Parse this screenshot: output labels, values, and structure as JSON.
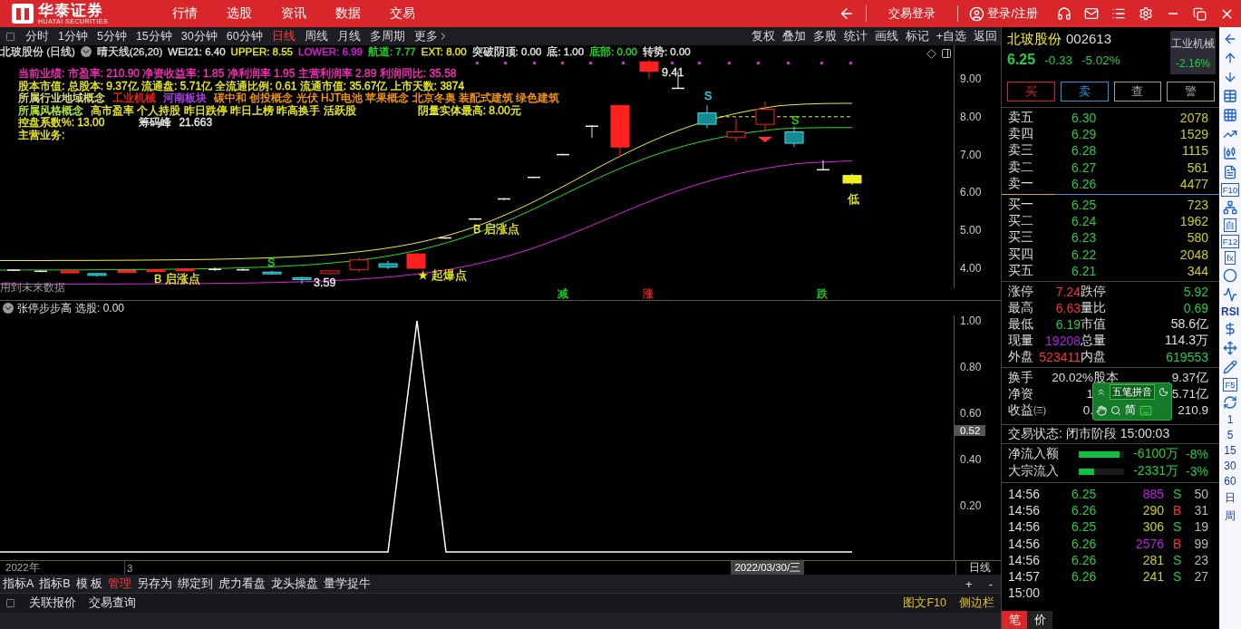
{
  "app": {
    "logo_cn": "华泰证券",
    "logo_en": "HUATAI SECURITIES"
  },
  "top_nav": [
    "行情",
    "选股",
    "资讯",
    "数据",
    "交易"
  ],
  "top_right": {
    "trade_login": "交易登录",
    "user": "登录/注册"
  },
  "periods": [
    {
      "label": "分时",
      "selected": false
    },
    {
      "label": "1分钟",
      "selected": false
    },
    {
      "label": "5分钟",
      "selected": false
    },
    {
      "label": "15分钟",
      "selected": false
    },
    {
      "label": "30分钟",
      "selected": false
    },
    {
      "label": "60分钟",
      "selected": false
    },
    {
      "label": "日线",
      "selected": true
    },
    {
      "label": "周线",
      "selected": false
    },
    {
      "label": "月线",
      "selected": false
    },
    {
      "label": "多周期",
      "selected": false
    },
    {
      "label": "更多",
      "selected": false
    }
  ],
  "chart_tools": [
    "复权",
    "叠加",
    "多股",
    "统计",
    "画线",
    "标记",
    "+自选",
    "返回"
  ],
  "chart_title": {
    "name": "北玻股份 (日线)",
    "indicator": "晴天线(26,20)",
    "params": [
      {
        "text": "WEI21: 6.40",
        "color": "#e6e6e6"
      },
      {
        "text": "UPPER: 8.55",
        "color": "#f0f000"
      },
      {
        "text": "LOWER: 6.99",
        "color": "#e020e0"
      },
      {
        "text": "航道: 7.77",
        "color": "#20e020"
      },
      {
        "text": "EXT: 8.00",
        "color": "#f0f000"
      },
      {
        "text": "突破阴顶: 0.00",
        "color": "#e6e6e6"
      },
      {
        "text": "底: 1.00",
        "color": "#e6e6e6"
      },
      {
        "text": "底部: 0.00",
        "color": "#20e020"
      },
      {
        "text": "转势: 0.00",
        "color": "#e6e6e6"
      }
    ]
  },
  "info_lines": [
    [
      {
        "text": "当前业绩: 市盈率: 210.90 净资收益率: 1.85 净利润率 1.95 主营利润率 2.89 利润同比: 35.58",
        "color": "#ff30c0"
      }
    ],
    [
      {
        "text": "股本市值: 总股本: 9.37亿 流通盘: 5.71亿 全流通比例: 0.61 流通市值: 35.67亿 上市天数: 3874",
        "color": "#f0f020"
      }
    ],
    [
      {
        "text": "所属行业地域概念",
        "color": "#e8e880"
      },
      {
        "text": "工业机械",
        "color": "#ff2020"
      },
      {
        "text": "河南板块",
        "color": "#c040ff"
      },
      {
        "text": "碳中和 创投概念 光伏 HJT电池 苹果概念 北京冬奥 装配式建筑 绿色建筑",
        "color": "#ff9a10"
      }
    ],
    [
      {
        "text": "所属风格概念",
        "color": "#b8f040"
      },
      {
        "text": "高市盈率 个人持股 昨日跌停 昨日上榜 昨高换手 活跃股",
        "color": "#f0f020"
      },
      {
        "text": "阴量实体最高:  8.00元",
        "color": "#f0f020"
      }
    ],
    [
      {
        "text": "控盘系数%:  13.00",
        "color": "#f0f020"
      },
      {
        "text": "筹码峰",
        "color": "#f0f0f0"
      },
      {
        "text": "21.663",
        "color": "#f0f0f0"
      }
    ],
    [
      {
        "text": "主营业务:",
        "color": "#f0f020"
      }
    ]
  ],
  "chart_labels": [
    {
      "text": "9.41",
      "color": "#f0f0f0"
    },
    {
      "text": "S",
      "color": "#30e0f0"
    },
    {
      "text": "S",
      "color": "#20e020"
    },
    {
      "text": "低",
      "color": "#f0f020"
    },
    {
      "text": "B 启涨点",
      "color": "#f0f020"
    },
    {
      "text": "B 启涨点",
      "color": "#f0f020"
    },
    {
      "text": "S",
      "color": "#20e020"
    },
    {
      "text": "3.59",
      "color": "#f0f0f0"
    },
    {
      "text": "★ 起爆点",
      "color": "#f0f020"
    }
  ],
  "price_ticks": [
    "9.00",
    "8.00",
    "7.00",
    "6.00",
    "5.00",
    "4.00"
  ],
  "future_note": "用到未来数据",
  "signals": [
    {
      "text": "减",
      "color": "#20c020"
    },
    {
      "text": "涨",
      "color": "#e02020"
    },
    {
      "text": "跌",
      "color": "#20c020"
    }
  ],
  "indicator": {
    "name": "张停步步高",
    "value": "选股: 0.00",
    "current": "0.52",
    "ticks": [
      "1.00",
      "0.80",
      "0.60",
      "0.40",
      "0.20"
    ]
  },
  "date_bar": {
    "year": "2022年",
    "month": "3",
    "cursor_date": "2022/03/30/三",
    "period": "日线"
  },
  "bottom_tabs": [
    {
      "label": "指标A",
      "selected": false
    },
    {
      "label": "指标B",
      "selected": false
    },
    {
      "label": "模 板",
      "selected": false
    },
    {
      "label": "管理",
      "selected": true
    },
    {
      "label": "另存为",
      "selected": false
    },
    {
      "label": "绑定到",
      "selected": false
    },
    {
      "label": "虎力看盘",
      "selected": false
    },
    {
      "label": "龙头操盘",
      "selected": false
    },
    {
      "label": "量学捉牛",
      "selected": false
    }
  ],
  "zoom_buttons": [
    "+",
    "-"
  ],
  "bottom_bar": {
    "left": [
      "关联报价",
      "交易查询"
    ],
    "right": [
      "图文F10",
      "侧边栏"
    ]
  },
  "quote": {
    "name": "北玻股份",
    "code": "002613",
    "price": "6.25",
    "change": "-0.33",
    "pct": "-5.02%",
    "sector": "工业机械",
    "sector_pct": "-2.16%"
  },
  "trade_buttons": [
    {
      "label": "买",
      "color": "#e02020"
    },
    {
      "label": "卖",
      "color": "#3090e0"
    },
    {
      "label": "查",
      "color": "#a0a0a0"
    },
    {
      "label": "警",
      "color": "#a0a0a0"
    }
  ],
  "asks": [
    {
      "label": "卖五",
      "price": "6.30",
      "volume": "2078"
    },
    {
      "label": "卖四",
      "price": "6.29",
      "volume": "1529"
    },
    {
      "label": "卖三",
      "price": "6.28",
      "volume": "1115"
    },
    {
      "label": "卖二",
      "price": "6.27",
      "volume": "561"
    },
    {
      "label": "卖一",
      "price": "6.26",
      "volume": "4477"
    }
  ],
  "bids": [
    {
      "label": "买一",
      "price": "6.25",
      "volume": "723"
    },
    {
      "label": "买二",
      "price": "6.24",
      "volume": "1962"
    },
    {
      "label": "买三",
      "price": "6.23",
      "volume": "580"
    },
    {
      "label": "买四",
      "price": "6.22",
      "volume": "2048"
    },
    {
      "label": "买五",
      "price": "6.21",
      "volume": "344"
    }
  ],
  "stats": [
    [
      {
        "label": "涨停",
        "value": "7.24",
        "color": "#ff3030"
      },
      {
        "label": "跌停",
        "value": "5.92",
        "color": "#20d040"
      }
    ],
    [
      {
        "label": "最高",
        "value": "6.63",
        "color": "#ff3030"
      },
      {
        "label": "量比",
        "value": "0.69",
        "color": "#20d040"
      }
    ],
    [
      {
        "label": "最低",
        "value": "6.19",
        "color": "#20d040"
      },
      {
        "label": "市值",
        "value": "58.6亿",
        "color": "#e0e0e0"
      }
    ],
    [
      {
        "label": "现量",
        "value": "19208",
        "color": "#b020e0"
      },
      {
        "label": "总量",
        "value": "114.3万",
        "color": "#e0e0e0"
      }
    ],
    [
      {
        "label": "外盘",
        "value": "523411",
        "color": "#ff3030"
      },
      {
        "label": "内盘",
        "value": "619553",
        "color": "#20d040"
      }
    ]
  ],
  "stats2": [
    [
      {
        "label": "换手",
        "value": "20.02%"
      },
      {
        "label": "股本",
        "value": "9.37亿"
      }
    ],
    [
      {
        "label": "净资",
        "value": "1"
      },
      {
        "value": "5.71亿"
      }
    ],
    [
      {
        "label": "收益㈢",
        "value": "0."
      },
      {
        "value": "210.9"
      }
    ]
  ],
  "ime": {
    "mode": "五笔拼音",
    "charset": "简"
  },
  "trade_status": "交易状态: 闭市阶段 15:00:03",
  "flows": [
    {
      "label": "净流入额",
      "level": 0.9,
      "amount": "-6100万",
      "pct": "-8%"
    },
    {
      "label": "大宗流入",
      "level": 0.33,
      "amount": "-2331万",
      "pct": "-3%"
    }
  ],
  "ticks": [
    {
      "time": "14:56",
      "price": "6.25",
      "volume": "885",
      "color": "#c020e0",
      "side": "S",
      "count": "50"
    },
    {
      "time": "14:56",
      "price": "6.26",
      "volume": "290",
      "color": "#d0d020",
      "side": "B",
      "count": "31"
    },
    {
      "time": "14:56",
      "price": "6.25",
      "volume": "306",
      "color": "#d0d020",
      "side": "S",
      "count": "19"
    },
    {
      "time": "14:56",
      "price": "6.26",
      "volume": "2576",
      "color": "#c020e0",
      "side": "B",
      "count": "99"
    },
    {
      "time": "14:56",
      "price": "6.26",
      "volume": "281",
      "color": "#d0d020",
      "side": "S",
      "count": "23"
    },
    {
      "time": "14:57",
      "price": "6.26",
      "volume": "241",
      "color": "#d0d020",
      "side": "S",
      "count": "27"
    },
    {
      "time": "15:00"
    }
  ],
  "detail_tabs": [
    {
      "label": "笔",
      "selected": true
    },
    {
      "label": "价",
      "selected": false
    }
  ],
  "side_strip": [
    {
      "kind": "icon"
    },
    {
      "kind": "icon"
    },
    {
      "kind": "icon"
    },
    {
      "kind": "icon"
    },
    {
      "kind": "icon"
    },
    {
      "kind": "icon"
    },
    {
      "kind": "icon"
    },
    {
      "kind": "icon"
    },
    {
      "kind": "label",
      "text": "F10"
    },
    {
      "kind": "icon"
    },
    {
      "kind": "label",
      "text": "自"
    },
    {
      "kind": "label",
      "text": "F12"
    },
    {
      "kind": "label",
      "text": "fx"
    },
    {
      "kind": "icon"
    },
    {
      "kind": "icon"
    },
    {
      "kind": "plain",
      "text": "RSI"
    },
    {
      "kind": "icon"
    },
    {
      "kind": "icon"
    },
    {
      "kind": "icon"
    },
    {
      "kind": "label",
      "text": "F5"
    },
    {
      "kind": "icon"
    },
    {
      "kind": "plain",
      "text": "1"
    },
    {
      "kind": "plain",
      "text": "5"
    },
    {
      "kind": "plain",
      "text": "15"
    },
    {
      "kind": "plain",
      "text": "30"
    },
    {
      "kind": "plain",
      "text": "60"
    },
    {
      "kind": "plain",
      "text": "日"
    },
    {
      "kind": "plain",
      "text": "周"
    }
  ]
}
